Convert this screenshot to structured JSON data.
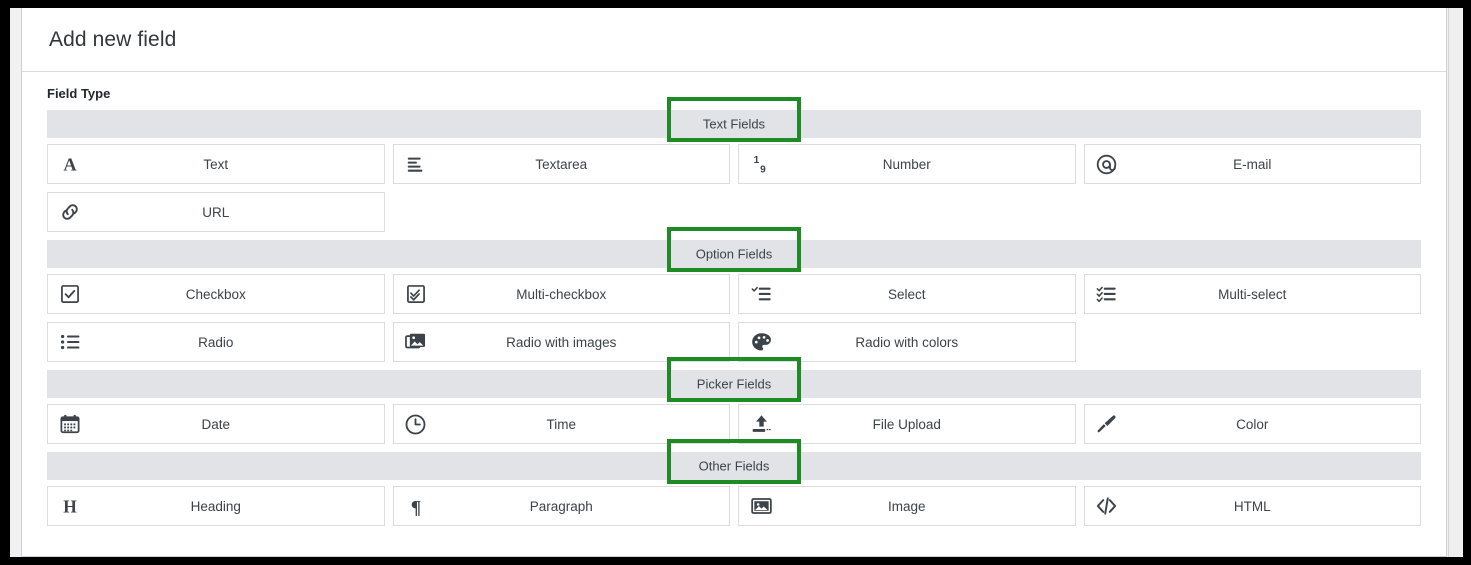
{
  "header": {
    "title": "Add new field"
  },
  "body": {
    "field_type_label": "Field Type"
  },
  "accent": {
    "highlight_color": "#1e8b25",
    "band_color": "#e2e3e7"
  },
  "groups": [
    {
      "band_label": "Text Fields",
      "tiles": [
        {
          "label": "Text",
          "icon": "letter-a-icon"
        },
        {
          "label": "Textarea",
          "icon": "text-lines-icon"
        },
        {
          "label": "Number",
          "icon": "number-one-nine-icon"
        },
        {
          "label": "E-mail",
          "icon": "at-sign-icon"
        },
        {
          "label": "URL",
          "icon": "link-chain-icon"
        }
      ]
    },
    {
      "band_label": "Option Fields",
      "tiles": [
        {
          "label": "Checkbox",
          "icon": "checkbox-icon"
        },
        {
          "label": "Multi-checkbox",
          "icon": "multi-checkbox-icon"
        },
        {
          "label": "Select",
          "icon": "select-list-icon"
        },
        {
          "label": "Multi-select",
          "icon": "multi-select-list-icon"
        },
        {
          "label": "Radio",
          "icon": "bulleted-list-icon"
        },
        {
          "label": "Radio with images",
          "icon": "images-stack-icon"
        },
        {
          "label": "Radio with colors",
          "icon": "color-palette-icon"
        }
      ]
    },
    {
      "band_label": "Picker Fields",
      "tiles": [
        {
          "label": "Date",
          "icon": "calendar-icon"
        },
        {
          "label": "Time",
          "icon": "clock-icon"
        },
        {
          "label": "File Upload",
          "icon": "upload-icon"
        },
        {
          "label": "Color",
          "icon": "paintbrush-icon"
        }
      ]
    },
    {
      "band_label": "Other Fields",
      "tiles": [
        {
          "label": "Heading",
          "icon": "letter-h-icon"
        },
        {
          "label": "Paragraph",
          "icon": "pilcrow-icon"
        },
        {
          "label": "Image",
          "icon": "image-frame-icon"
        },
        {
          "label": "HTML",
          "icon": "code-tags-icon"
        }
      ]
    }
  ]
}
